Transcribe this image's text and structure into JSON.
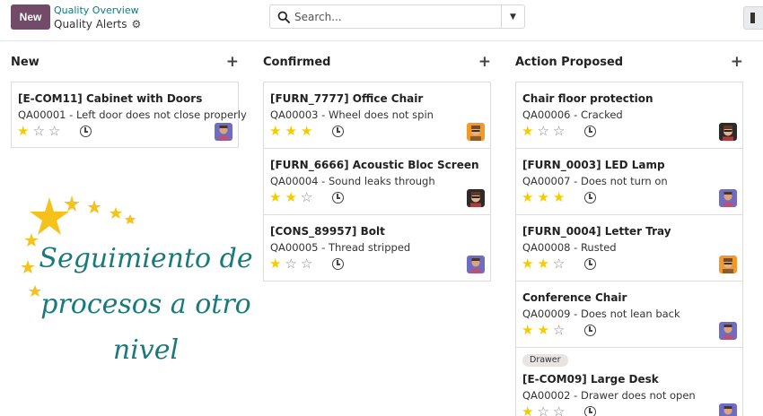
{
  "toolbar": {
    "new_label": "New"
  },
  "breadcrumb": {
    "parent": "Quality Overview",
    "current": "Quality Alerts"
  },
  "search": {
    "placeholder": "Search..."
  },
  "columns": [
    {
      "title": "New",
      "cards": [
        {
          "title": "[E-COM11] Cabinet with Doors",
          "desc": "QA00001 - Left door does not close properly",
          "rating": 1,
          "avatar": "purple-avatar"
        }
      ]
    },
    {
      "title": "Confirmed",
      "cards": [
        {
          "title": "[FURN_7777] Office Chair",
          "desc": "QA00003 - Wheel does not spin",
          "rating": 3,
          "avatar": "orange-avatar"
        },
        {
          "title": "[FURN_6666] Acoustic Bloc Screen",
          "desc": "QA00004 - Sound leaks through",
          "rating": 2,
          "avatar": "dark-avatar"
        },
        {
          "title": "[CONS_89957] Bolt",
          "desc": "QA00005 - Thread stripped",
          "rating": 1,
          "avatar": "purple-avatar"
        }
      ]
    },
    {
      "title": "Action Proposed",
      "cards": [
        {
          "title": "Chair floor protection",
          "desc": "QA00006 - Cracked",
          "rating": 1,
          "avatar": "dark-avatar"
        },
        {
          "title": "[FURN_0003] LED Lamp",
          "desc": "QA00007 - Does not turn on",
          "rating": 3,
          "avatar": "purple-avatar"
        },
        {
          "title": "[FURN_0004] Letter Tray",
          "desc": "QA00008 - Rusted",
          "rating": 2,
          "avatar": "orange-avatar"
        },
        {
          "title": "Conference Chair",
          "desc": "QA00009 - Does not lean back",
          "rating": 2,
          "avatar": "purple-avatar"
        },
        {
          "tag": "Drawer",
          "title": "[E-COM09] Large Desk",
          "desc": "QA00002 - Drawer does not open",
          "rating": 1,
          "avatar": "purple-avatar"
        }
      ]
    }
  ],
  "promo": {
    "line1": "Seguimiento de",
    "line2": "procesos a otro",
    "line3": "nivel"
  },
  "colors": {
    "brand": "#714B67",
    "link": "#017e84",
    "star": "#f3cc00",
    "promo_text": "#197a7c"
  }
}
